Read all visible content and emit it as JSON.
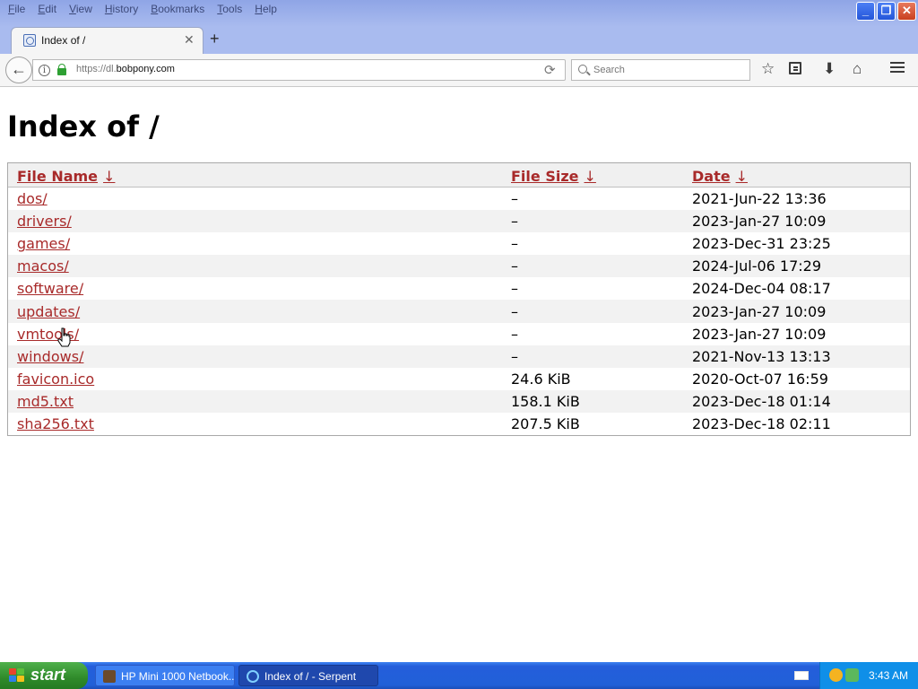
{
  "menu": [
    "File",
    "Edit",
    "View",
    "History",
    "Bookmarks",
    "Tools",
    "Help"
  ],
  "tab": {
    "title": "Index of /"
  },
  "address": {
    "prefix": "https://dl.",
    "domain": "bobpony.com"
  },
  "search": {
    "placeholder": "Search"
  },
  "page": {
    "title": "Index of /"
  },
  "table": {
    "headers": {
      "name": "File Name",
      "size": "File Size",
      "date": "Date",
      "sort_arrow": "↓"
    },
    "rows": [
      {
        "name": "dos/",
        "size": "–",
        "date": "2021-Jun-22 13:36"
      },
      {
        "name": "drivers/",
        "size": "–",
        "date": "2023-Jan-27 10:09"
      },
      {
        "name": "games/",
        "size": "–",
        "date": "2023-Dec-31 23:25"
      },
      {
        "name": "macos/",
        "size": "–",
        "date": "2024-Jul-06 17:29"
      },
      {
        "name": "software/",
        "size": "–",
        "date": "2024-Dec-04 08:17"
      },
      {
        "name": "updates/",
        "size": "–",
        "date": "2023-Jan-27 10:09"
      },
      {
        "name": "vmtools/",
        "size": "–",
        "date": "2023-Jan-27 10:09"
      },
      {
        "name": "windows/",
        "size": "–",
        "date": "2021-Nov-13 13:13"
      },
      {
        "name": "favicon.ico",
        "size": "24.6 KiB",
        "date": "2020-Oct-07 16:59"
      },
      {
        "name": "md5.txt",
        "size": "158.1 KiB",
        "date": "2023-Dec-18 01:14"
      },
      {
        "name": "sha256.txt",
        "size": "207.5 KiB",
        "date": "2023-Dec-18 02:11"
      }
    ]
  },
  "taskbar": {
    "start_label": "start",
    "tasks": [
      "HP Mini 1000 Netbook...",
      "Index of / - Serpent"
    ],
    "clock": "3:43 AM"
  },
  "colors": {
    "link": "#a82a2a",
    "taskbar": "#245edb",
    "start": "#2f8a2a",
    "tray": "#0f8fe8"
  }
}
